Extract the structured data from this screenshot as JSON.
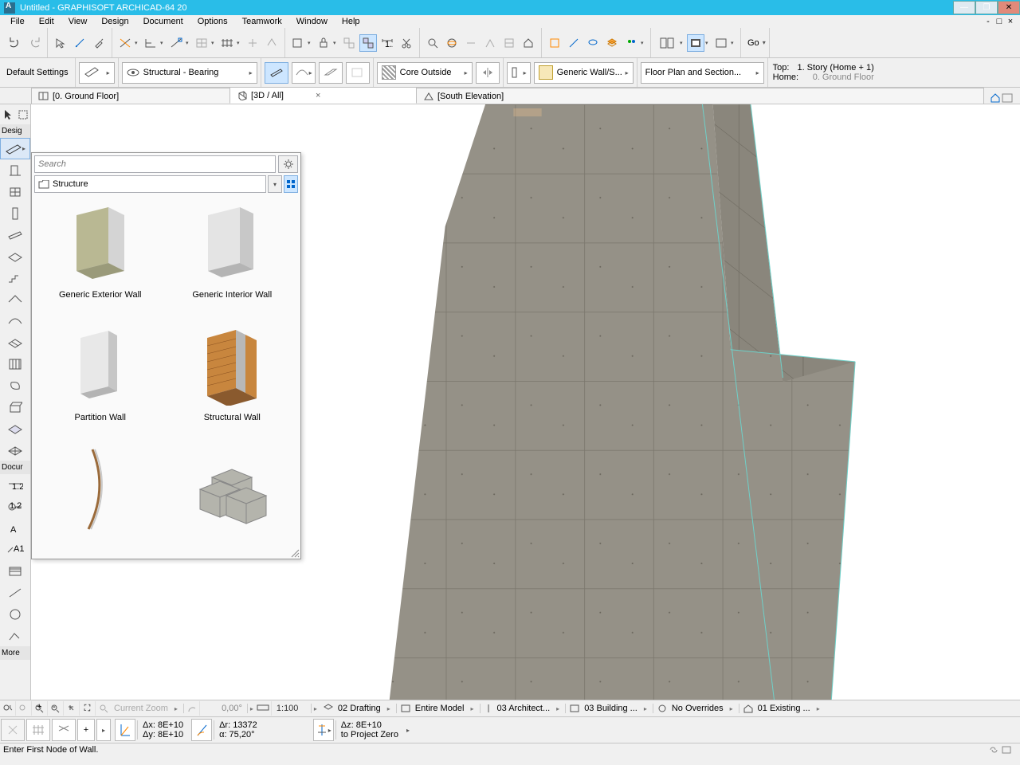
{
  "app": {
    "title": "Untitled - GRAPHISOFT ARCHICAD-64 20"
  },
  "menu": {
    "items": [
      "File",
      "Edit",
      "View",
      "Design",
      "Document",
      "Options",
      "Teamwork",
      "Window",
      "Help"
    ]
  },
  "toolbar_go": "Go",
  "optionbar": {
    "defaults": "Default Settings",
    "structural": "Structural - Bearing",
    "core": "Core Outside",
    "wall": "Generic Wall/S...",
    "floorplan": "Floor Plan and Section...",
    "top_label": "Top:",
    "top_value": "1. Story (Home + 1)",
    "home_label": "Home:",
    "home_value": "0. Ground Floor"
  },
  "tabs": {
    "t1": "[0. Ground Floor]",
    "t2": "[3D / All]",
    "t3": "[South Elevation]"
  },
  "toolbox": {
    "design_label": "Desig",
    "document_label": "Docur",
    "more_label": "More"
  },
  "favorites": {
    "search_placeholder": "Search",
    "folder": "Structure",
    "items": [
      "Generic Exterior Wall",
      "Generic Interior Wall",
      "Partition Wall",
      "Structural Wall",
      "",
      ""
    ]
  },
  "status1": {
    "more": "More",
    "zoom": "Current Zoom",
    "angle": "0,00°",
    "scale": "1:100",
    "l1": "02 Drafting",
    "l2": "Entire Model",
    "l3": "03 Architect...",
    "l4": "03 Building ...",
    "l5": "No Overrides",
    "l6": "01 Existing ..."
  },
  "status2": {
    "dx": "Δx: 8E+10",
    "dy": "Δy: 8E+10",
    "dr": "Δr: 13372",
    "da": "α: 75,20°",
    "dz": "Δz: 8E+10",
    "zero": "to Project Zero"
  },
  "status3": {
    "msg": "Enter First Node of Wall."
  }
}
